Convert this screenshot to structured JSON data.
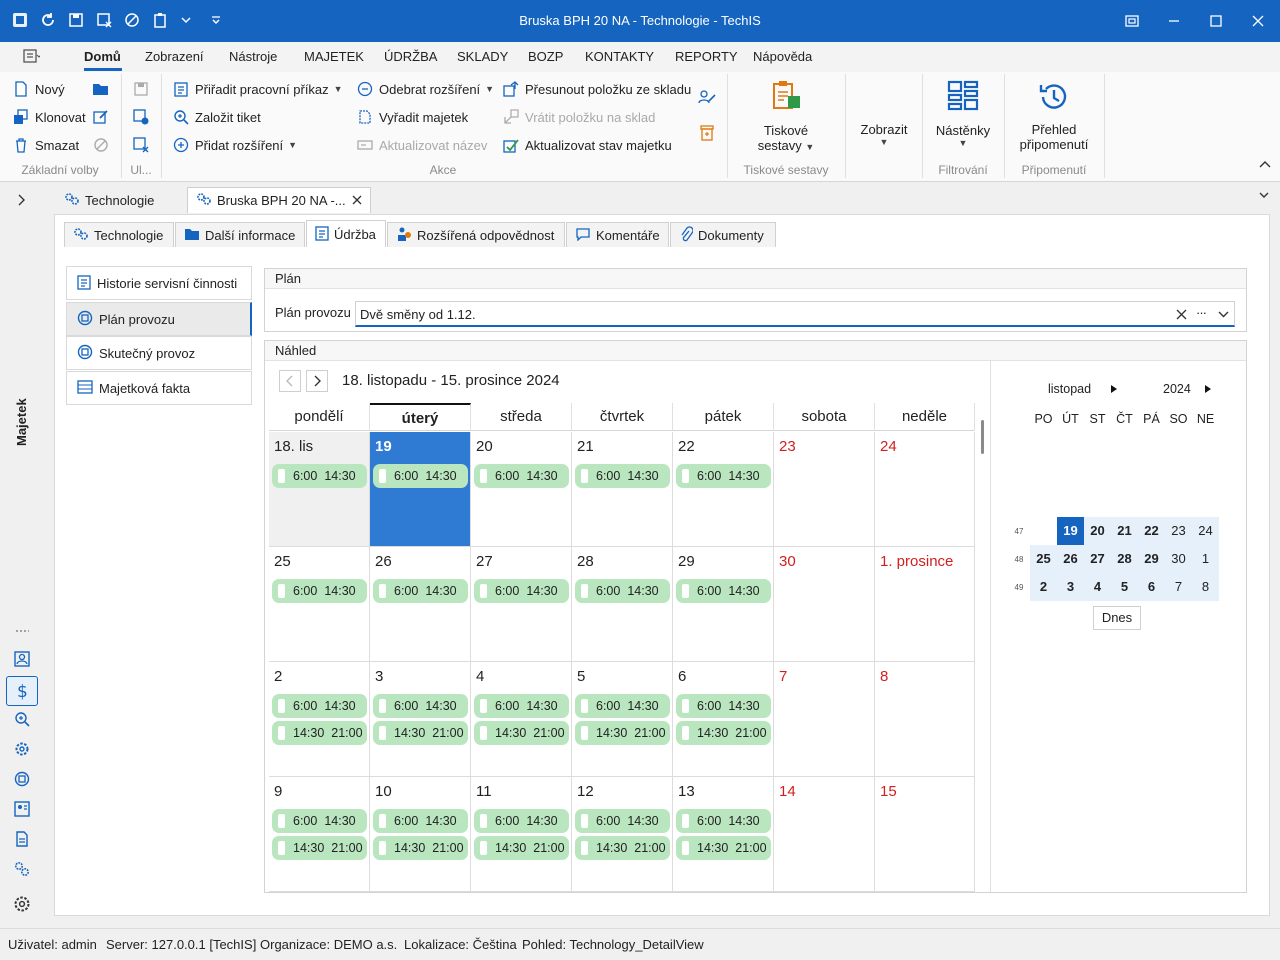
{
  "window": {
    "title": "Bruska BPH 20 NA - Technologie - TechIS"
  },
  "menu": [
    "Domů",
    "Zobrazení",
    "Nástroje",
    "MAJETEK",
    "ÚDRŽBA",
    "SKLADY",
    "BOZP",
    "KONTAKTY",
    "REPORTY",
    "Nápověda"
  ],
  "ribbon": {
    "basic": {
      "new": "Nový",
      "clone": "Klonovat",
      "delete": "Smazat",
      "label": "Základní volby"
    },
    "ul_label": "Ul...",
    "actions": {
      "assign_order": "Přiřadit pracovní příkaz",
      "create_ticket": "Založit tiket",
      "add_extension": "Přidat rozšíření",
      "remove_extension": "Odebrat rozšíření",
      "decommission": "Vyřadit majetek",
      "update_name": "Aktualizovat název",
      "move_item": "Přesunout položku ze skladu",
      "return_item": "Vrátit položku na sklad",
      "update_state": "Aktualizovat stav majetku",
      "label": "Akce"
    },
    "print": {
      "line1": "Tiskové",
      "line2": "sestavy",
      "label": "Tiskové sestavy"
    },
    "show": {
      "label": "Zobrazit"
    },
    "boards": {
      "label": "Nástěnky",
      "group": "Filtrování"
    },
    "reminders": {
      "line1": "Přehled",
      "line2": "připomenutí",
      "group": "Připomenutí"
    }
  },
  "sidebar": {
    "label": "Majetek"
  },
  "doc_tabs": [
    "Technologie",
    "Bruska BPH 20 NA -..."
  ],
  "inner_tabs": [
    "Technologie",
    "Další informace",
    "Údržba",
    "Rozšířená odpovědnost",
    "Komentáře",
    "Dokumenty"
  ],
  "left_nav": [
    "Historie servisní činnosti",
    "Plán provozu",
    "Skutečný provoz",
    "Majetková fakta"
  ],
  "plan": {
    "group": "Plán",
    "label": "Plán provozu",
    "value": "Dvě směny od 1.12."
  },
  "preview": {
    "group": "Náhled",
    "range": "18. listopadu - 15. prosince 2024"
  },
  "calendar": {
    "weekdays": [
      "pondělí",
      "úterý",
      "středa",
      "čtvrtek",
      "pátek",
      "sobota",
      "neděle"
    ],
    "weeks": [
      [
        "18. lis",
        "19",
        "20",
        "21",
        "22",
        "23",
        "24"
      ],
      [
        "25",
        "26",
        "27",
        "28",
        "29",
        "30",
        "1. prosince"
      ],
      [
        "2",
        "3",
        "4",
        "5",
        "6",
        "7",
        "8"
      ],
      [
        "9",
        "10",
        "11",
        "12",
        "13",
        "14",
        "15"
      ]
    ],
    "shift1": {
      "start": "6:00",
      "end": "14:30"
    },
    "shift2": {
      "start": "14:30",
      "end": "21:00"
    }
  },
  "mini": {
    "month": "listopad",
    "year": "2024",
    "days": [
      "PO",
      "ÚT",
      "ST",
      "ČT",
      "PÁ",
      "SO",
      "NE"
    ],
    "weeks": [
      {
        "no": "47",
        "dates": [
          "",
          "19",
          "20",
          "21",
          "22",
          "23",
          "24"
        ]
      },
      {
        "no": "48",
        "dates": [
          "25",
          "26",
          "27",
          "28",
          "29",
          "30",
          "1"
        ]
      },
      {
        "no": "49",
        "dates": [
          "2",
          "3",
          "4",
          "5",
          "6",
          "7",
          "8"
        ]
      }
    ],
    "today": "Dnes"
  },
  "status": {
    "user": "Uživatel: admin",
    "server": "Server: 127.0.0.1 [TechIS]",
    "org": "Organizace: DEMO a.s.",
    "locale": "Lokalizace: Čeština",
    "view": "Pohled: Technology_DetailView"
  },
  "colors": {
    "accent": "#1565c0",
    "shift": "#b9e6bf",
    "today": "#2f7bd3",
    "weekend": "#d11f1f"
  }
}
